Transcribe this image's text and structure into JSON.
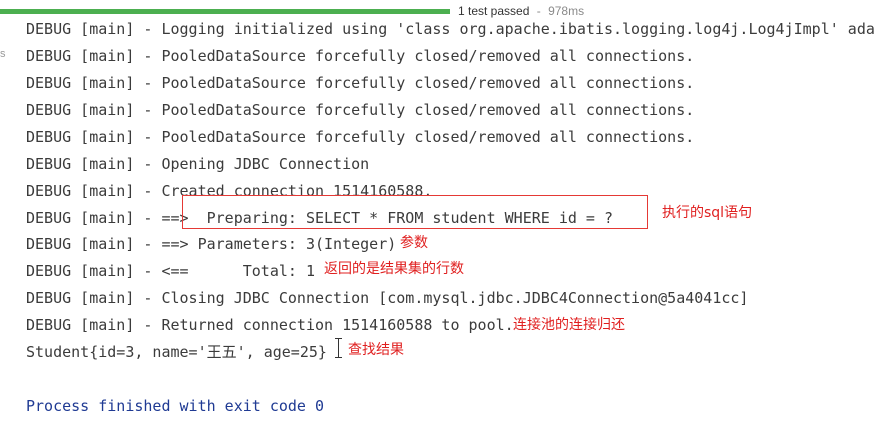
{
  "status": {
    "progress": 1.0,
    "text": "1 test passed",
    "separator": " - ",
    "time": "978ms"
  },
  "gutter": {
    "mark": "s"
  },
  "console": {
    "lines": [
      "DEBUG [main] - Logging initialized using 'class org.apache.ibatis.logging.log4j.Log4jImpl' adap",
      "DEBUG [main] - PooledDataSource forcefully closed/removed all connections.",
      "DEBUG [main] - PooledDataSource forcefully closed/removed all connections.",
      "DEBUG [main] - PooledDataSource forcefully closed/removed all connections.",
      "DEBUG [main] - PooledDataSource forcefully closed/removed all connections.",
      "DEBUG [main] - Opening JDBC Connection",
      "DEBUG [main] - Created connection 1514160588.",
      "DEBUG [main] - ==>  Preparing: SELECT * FROM student WHERE id = ?",
      "DEBUG [main] - ==> Parameters: 3(Integer)",
      "DEBUG [main] - <==      Total: 1",
      "DEBUG [main] - Closing JDBC Connection [com.mysql.jdbc.JDBC4Connection@5a4041cc]",
      "DEBUG [main] - Returned connection 1514160588 to pool.",
      "Student{id=3, name='王五', age=25}",
      "",
      "Process finished with exit code 0"
    ]
  },
  "annotations": {
    "sql": "执行的sql语句",
    "params": "参数",
    "rows": "返回的是结果集的行数",
    "pool": "连接池的连接归还",
    "result": "查找结果"
  },
  "colors": {
    "annotation": "#e02020",
    "progress": "#4caf50",
    "exit_text": "#1f3a93"
  }
}
